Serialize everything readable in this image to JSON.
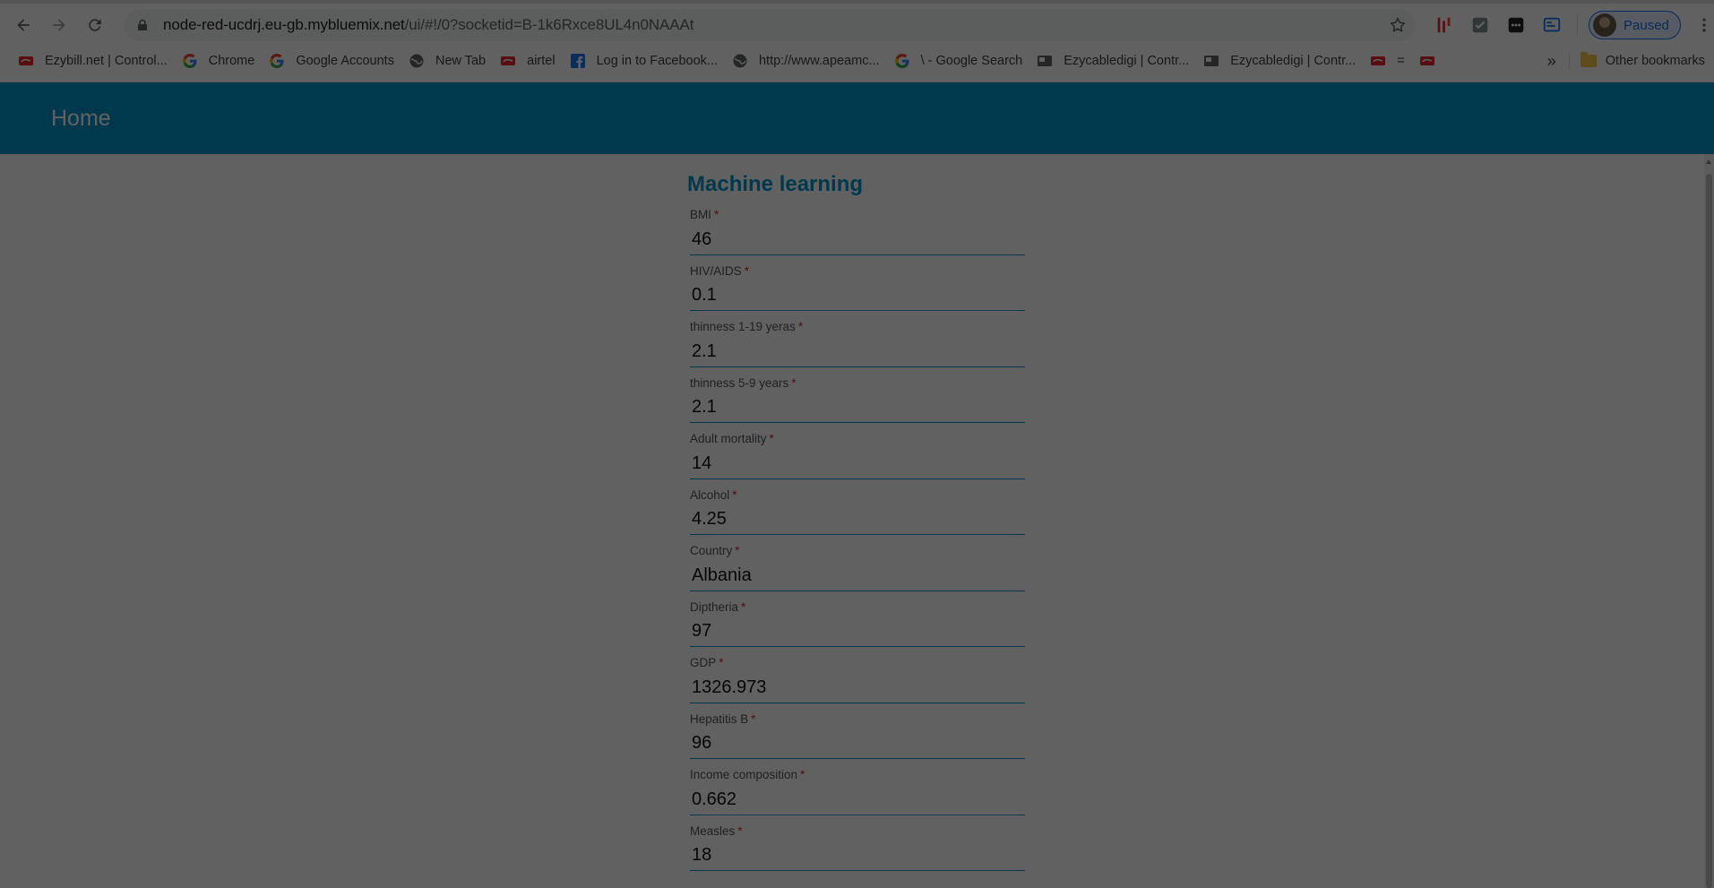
{
  "browser": {
    "url_host": "node-red-ucdrj.eu-gb.mybluemix.net",
    "url_path": "/ui/#!/0?socketid=B-1k6Rxce8UL4n0NAAAt",
    "profile_label": "Paused",
    "bookmarks": [
      {
        "label": "Ezybill.net | Control...",
        "icon": "airtel-icon"
      },
      {
        "label": "Chrome",
        "icon": "google-icon"
      },
      {
        "label": "Google Accounts",
        "icon": "google-icon"
      },
      {
        "label": "New Tab",
        "icon": "globe-icon"
      },
      {
        "label": "airtel",
        "icon": "airtel-icon"
      },
      {
        "label": "Log in to Facebook...",
        "icon": "facebook-icon"
      },
      {
        "label": "http://www.apeamc...",
        "icon": "globe-icon"
      },
      {
        "label": "\\ - Google Search",
        "icon": "google-icon"
      },
      {
        "label": "Ezycabledigi | Contr...",
        "icon": "page-icon"
      },
      {
        "label": "Ezycabledigi | Contr...",
        "icon": "page-icon"
      },
      {
        "label": "=",
        "icon": "airtel-icon"
      },
      {
        "label": "",
        "icon": "airtel-icon"
      }
    ],
    "more_label": "»",
    "other_bookmarks": "Other bookmarks"
  },
  "header": {
    "title": "Home"
  },
  "form": {
    "title": "Machine learning",
    "required_mark": "*",
    "fields": [
      {
        "label": "BMI",
        "value": "46"
      },
      {
        "label": "HIV/AIDS",
        "value": "0.1"
      },
      {
        "label": "thinness 1-19 yeras",
        "value": "2.1"
      },
      {
        "label": "thinness 5-9 years",
        "value": "2.1"
      },
      {
        "label": "Adult mortality",
        "value": "14"
      },
      {
        "label": "Alcohol",
        "value": "4.25"
      },
      {
        "label": "Country",
        "value": "Albania"
      },
      {
        "label": "Diptheria",
        "value": "97"
      },
      {
        "label": "GDP",
        "value": "1326.973"
      },
      {
        "label": "Hepatitis B",
        "value": "96"
      },
      {
        "label": "Income composition",
        "value": "0.662"
      },
      {
        "label": "Measles",
        "value": "18"
      }
    ]
  },
  "colors": {
    "header_bg": "#0094ce",
    "accent": "#0094ce",
    "required": "#d32f2f",
    "overlay": "rgba(0,0,0,0.62)"
  }
}
